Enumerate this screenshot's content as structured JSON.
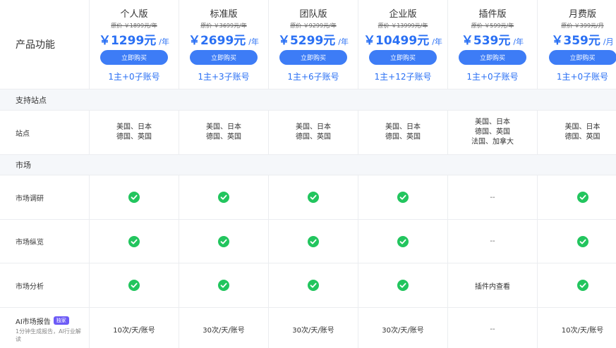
{
  "header": {
    "feature_label": "产品功能",
    "plans": [
      {
        "name": "个人版",
        "original": "原价 ￥1899元/年",
        "price": "￥1299元",
        "period": "/年",
        "buy": "立即购买",
        "accounts": "1主+0子账号"
      },
      {
        "name": "标准版",
        "original": "原价 ￥3699元/年",
        "price": "￥2699元",
        "period": "/年",
        "buy": "立即购买",
        "accounts": "1主+3子账号"
      },
      {
        "name": "团队版",
        "original": "原价 ￥9299元/年",
        "price": "￥5299元",
        "period": "/年",
        "buy": "立即购买",
        "accounts": "1主+6子账号"
      },
      {
        "name": "企业版",
        "original": "原价 ￥13999元/年",
        "price": "￥10499元",
        "period": "/年",
        "buy": "立即购买",
        "accounts": "1主+12子账号"
      },
      {
        "name": "插件版",
        "original": "原价 ￥599元/年",
        "price": "￥539元",
        "period": "/年",
        "buy": "立即购买",
        "accounts": "1主+0子账号"
      },
      {
        "name": "月费版",
        "original": "原价 ￥399元/月",
        "price": "￥359元",
        "period": "/月",
        "buy": "立即购买",
        "accounts": "1主+0子账号"
      }
    ]
  },
  "sections": {
    "sites": "支持站点",
    "market": "市场"
  },
  "rows": {
    "site": {
      "label": "站点",
      "values": [
        [
          "美国、日本",
          "德国、英国"
        ],
        [
          "美国、日本",
          "德国、英国"
        ],
        [
          "美国、日本",
          "德国、英国"
        ],
        [
          "美国、日本",
          "德国、英国"
        ],
        [
          "美国、日本",
          "德国、英国",
          "法国、加拿大"
        ],
        [
          "美国、日本",
          "德国、英国"
        ]
      ]
    },
    "research": {
      "label": "市场调研",
      "values": [
        "check",
        "check",
        "check",
        "check",
        "--",
        "check"
      ]
    },
    "overview": {
      "label": "市场纵览",
      "values": [
        "check",
        "check",
        "check",
        "check",
        "--",
        "check"
      ]
    },
    "analysis": {
      "label": "市场分析",
      "values": [
        "check",
        "check",
        "check",
        "check",
        "插件内查看",
        "check"
      ]
    },
    "ai_report": {
      "label": "AI市场报告",
      "badge": "独家",
      "desc": "1分钟生成报告，AI行业解读",
      "values": [
        "10次/天/账号",
        "30次/天/账号",
        "30次/天/账号",
        "30次/天/账号",
        "--",
        "10次/天/账号"
      ]
    }
  },
  "colors": {
    "accent": "#2a70f4",
    "button": "#3d7cf6",
    "check": "#22c55e",
    "badge": "#6d5bf6",
    "section_bg": "#f5f7fa"
  }
}
